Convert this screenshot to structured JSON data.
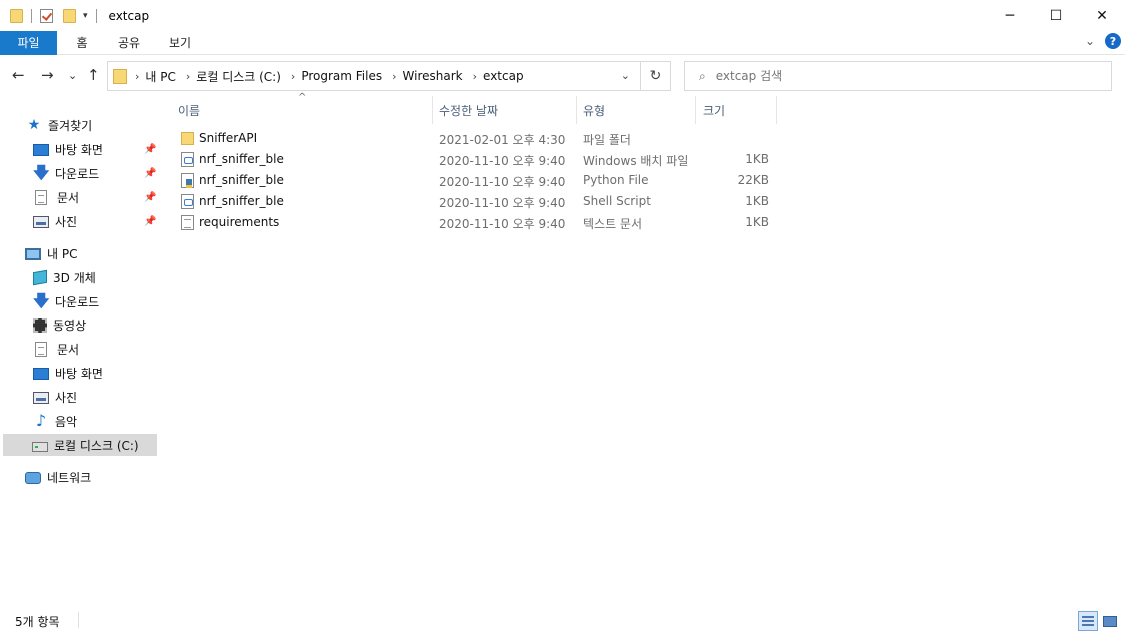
{
  "window": {
    "title": "extcap",
    "controls": {
      "minimize": "─",
      "maximize": "☐",
      "close": "✕"
    }
  },
  "ribbon": {
    "tabs": [
      "파일",
      "홈",
      "공유",
      "보기"
    ],
    "help": "?",
    "collapse": "⌄"
  },
  "address": {
    "crumbs": [
      "내 PC",
      "로컬 디스크 (C:)",
      "Program Files",
      "Wireshark",
      "extcap"
    ],
    "crumb_sep": "›",
    "refresh": "↻",
    "dropdown": "⌄"
  },
  "search": {
    "placeholder": "extcap 검색",
    "icon": "⌕"
  },
  "nav": {
    "back": "←",
    "forward": "→",
    "recent": "⌄",
    "up": "↑"
  },
  "sidebar": {
    "quick_access": "즐겨찾기",
    "quick_items": [
      "바탕 화면",
      "다운로드",
      "문서",
      "사진"
    ],
    "this_pc": "내 PC",
    "pc_items": [
      "3D 개체",
      "다운로드",
      "동영상",
      "문서",
      "바탕 화면",
      "사진",
      "음악",
      "로컬 디스크 (C:)"
    ],
    "network": "네트워크",
    "pin_glyph": "📌"
  },
  "columns": {
    "name": "이름",
    "date": "수정한 날짜",
    "type": "유형",
    "size": "크기",
    "sort_glyph": "^"
  },
  "files": [
    {
      "icon": "folder",
      "name": "SnifferAPI",
      "date": "2021-02-01 오후 4:30",
      "type": "파일 폴더",
      "size": ""
    },
    {
      "icon": "bat",
      "name": "nrf_sniffer_ble",
      "date": "2020-11-10 오후 9:40",
      "type": "Windows 배치 파일",
      "size": "1KB"
    },
    {
      "icon": "py",
      "name": "nrf_sniffer_ble",
      "date": "2020-11-10 오후 9:40",
      "type": "Python File",
      "size": "22KB"
    },
    {
      "icon": "bat",
      "name": "nrf_sniffer_ble",
      "date": "2020-11-10 오후 9:40",
      "type": "Shell Script",
      "size": "1KB"
    },
    {
      "icon": "txt",
      "name": "requirements",
      "date": "2020-11-10 오후 9:40",
      "type": "텍스트 문서",
      "size": "1KB"
    }
  ],
  "status": {
    "item_count": "5개 항목"
  }
}
